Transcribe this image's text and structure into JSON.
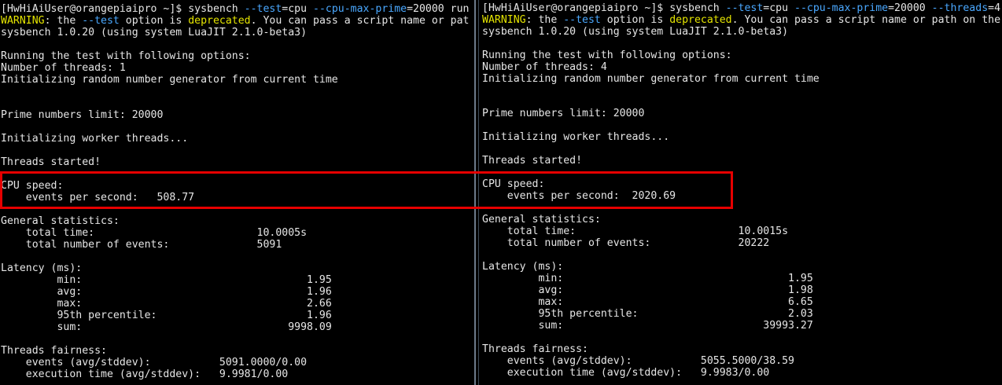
{
  "colors": {
    "background": "#000000",
    "text": "#e6e6e6",
    "warning": "#e5e500",
    "option": "#4aa8ff",
    "highlight_box": "#e60000"
  },
  "left": {
    "prompt": "[HwHiAiUser@orangepiaipro ~]$ ",
    "cmd_sysbench": "sysbench ",
    "cmd_test_opt": "--test",
    "cmd_test_val": "=cpu ",
    "cmd_maxprime_opt": "--cpu-max-prime",
    "cmd_maxprime_val": "=20000 run",
    "warn_label": "WARNING",
    "warn_1": ": the ",
    "warn_opt": "--test",
    "warn_2": " option is ",
    "warn_dep": "deprecated",
    "warn_3": ". You can pass a script name or pat",
    "version": "sysbench 1.0.20 (using system LuaJIT 2.1.0-beta3)",
    "running": "Running the test with following options:",
    "threads": "Number of threads: 1",
    "init_rng": "Initializing random number generator from current time",
    "prime_limit": "Prime numbers limit: 20000",
    "init_workers": "Initializing worker threads...",
    "threads_started": "Threads started!",
    "cpu_speed": "CPU speed:",
    "events_per_sec": "    events per second:   508.77",
    "general_stats": "General statistics:",
    "total_time": "    total time:                          10.0005s",
    "total_events": "    total number of events:              5091",
    "latency": "Latency (ms):",
    "lat_min": "         min:                                    1.95",
    "lat_avg": "         avg:                                    1.96",
    "lat_max": "         max:                                    2.66",
    "lat_95": "         95th percentile:                        1.96",
    "lat_sum": "         sum:                                 9998.09",
    "fairness": "Threads fairness:",
    "fair_events": "    events (avg/stddev):           5091.0000/0.00",
    "fair_exec": "    execution time (avg/stddev):   9.9981/0.00"
  },
  "right": {
    "prompt": "[HwHiAiUser@orangepiaipro ~]$ ",
    "cmd_sysbench": "sysbench ",
    "cmd_test_opt": "--test",
    "cmd_test_val": "=cpu ",
    "cmd_maxprime_opt": "--cpu-max-prime",
    "cmd_maxprime_val": "=20000 ",
    "cmd_threads_opt": "--threads",
    "cmd_threads_val": "=4",
    "warn_label": "WARNING",
    "warn_1": ": the ",
    "warn_opt": "--test",
    "warn_2": " option is ",
    "warn_dep": "deprecated",
    "warn_3": ". You can pass a script name or path on the",
    "version": "sysbench 1.0.20 (using system LuaJIT 2.1.0-beta3)",
    "running": "Running the test with following options:",
    "threads": "Number of threads: 4",
    "init_rng": "Initializing random number generator from current time",
    "prime_limit": "Prime numbers limit: 20000",
    "init_workers": "Initializing worker threads...",
    "threads_started": "Threads started!",
    "cpu_speed": "CPU speed:",
    "events_per_sec": "    events per second:  2020.69",
    "general_stats": "General statistics:",
    "total_time": "    total time:                          10.0015s",
    "total_events": "    total number of events:              20222",
    "latency": "Latency (ms):",
    "lat_min": "         min:                                    1.95",
    "lat_avg": "         avg:                                    1.98",
    "lat_max": "         max:                                    6.65",
    "lat_95": "         95th percentile:                        2.03",
    "lat_sum": "         sum:                                39993.27",
    "fairness": "Threads fairness:",
    "fair_events": "    events (avg/stddev):           5055.5000/38.59",
    "fair_exec": "    execution time (avg/stddev):   9.9983/0.00"
  }
}
